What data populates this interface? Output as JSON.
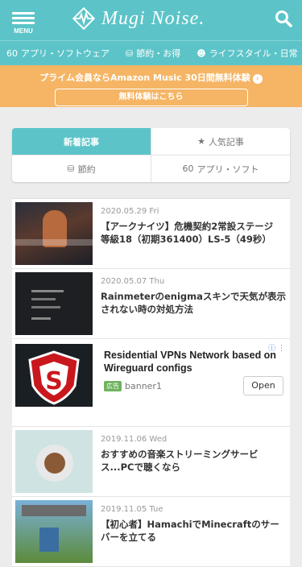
{
  "header": {
    "menu_label": "MENU",
    "site_name": "Mugi Noise."
  },
  "categories": [
    {
      "icon": "glasses-icon",
      "glyph": "60",
      "label": "アプリ・ソフトウェア"
    },
    {
      "icon": "coins-icon",
      "glyph": "⛁",
      "label": "節約・お得"
    },
    {
      "icon": "smile-icon",
      "glyph": "☻",
      "label": "ライフスタイル・日常"
    },
    {
      "icon": "monitor-icon",
      "glyph": "▭",
      "label": ""
    }
  ],
  "promo": {
    "text": "プライム会員ならAmazon Music 30日間無料体験",
    "button": "無料体験はこちら"
  },
  "tabs": [
    {
      "label": "新着記事",
      "icon": "",
      "active": true
    },
    {
      "label": "人気記事",
      "icon": "★"
    },
    {
      "label": "節約",
      "icon": "⛁"
    },
    {
      "label": "アプリ・ソフト",
      "icon": "60"
    }
  ],
  "articles": [
    {
      "date": "2020.05.29 Fri",
      "title": "【アークナイツ】危機契約2常設ステージ　等級18（初期361400）LS-5（49秒）"
    },
    {
      "date": "2020.05.07 Thu",
      "title": "Rainmeterのenigmaスキンで天気が表示されない時の対処方法"
    }
  ],
  "ad": {
    "title": "Residential VPNs Network based on Wireguard configs",
    "tag": "広告",
    "sponsor": "banner1",
    "open": "Open",
    "info": "ⓘ ⋮"
  },
  "articles2": [
    {
      "date": "2019.11.06 Wed",
      "title": "おすすめの音楽ストリーミングサービス...PCで聴くなら"
    },
    {
      "date": "2019.11.05 Tue",
      "title": "【初心者】HamachiでMinecraftのサーバーを立てる"
    }
  ]
}
